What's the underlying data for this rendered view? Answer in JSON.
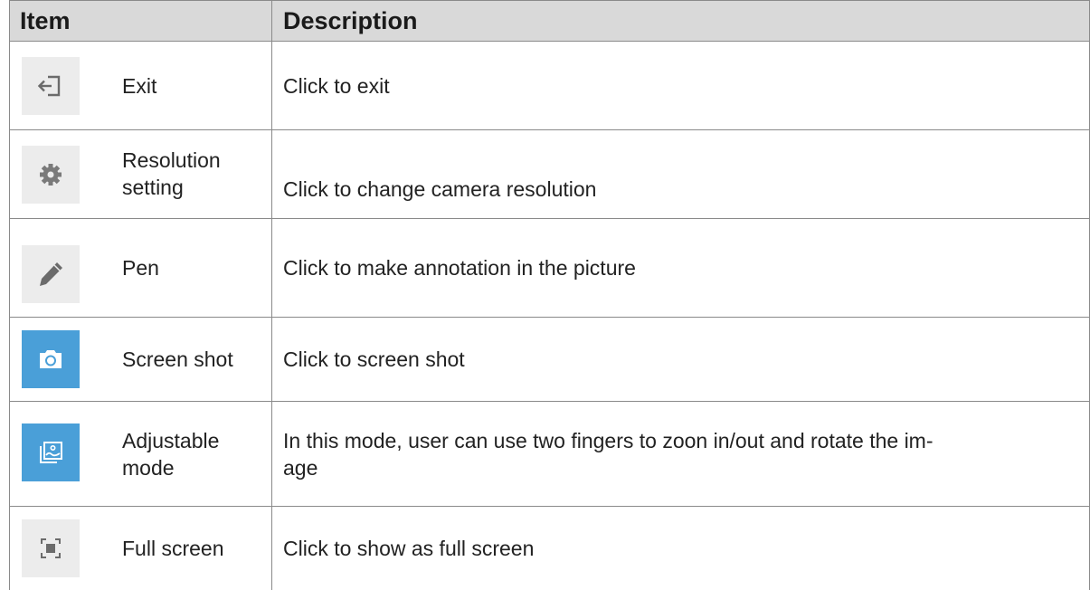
{
  "table": {
    "headers": {
      "item": "Item",
      "description": "Description"
    },
    "rows": [
      {
        "icon": "exit-icon",
        "item": "Exit",
        "description": "Click to exit"
      },
      {
        "icon": "gear-icon",
        "item_line1": "Resolution",
        "item_line2": "setting",
        "description": "Click to change camera resolution"
      },
      {
        "icon": "pen-icon",
        "item": "Pen",
        "description": "Click to make annotation in the picture"
      },
      {
        "icon": "camera-icon",
        "item": "Screen shot",
        "description": "Click to screen shot"
      },
      {
        "icon": "adjustable-image-icon",
        "item_line1": "Adjustable",
        "item_line2": "mode",
        "description_line1": "In this mode, user can use two fingers to zoon in/out and rotate the im-",
        "description_line2": "age"
      },
      {
        "icon": "fullscreen-icon",
        "item": "Full screen",
        "description": "Click to show as full screen"
      }
    ]
  },
  "colors": {
    "header_bg": "#d9d9d9",
    "border": "#8a8a8a",
    "blue_icon_bg": "#4a9fd8",
    "grey_icon_bg": "#ececec"
  }
}
